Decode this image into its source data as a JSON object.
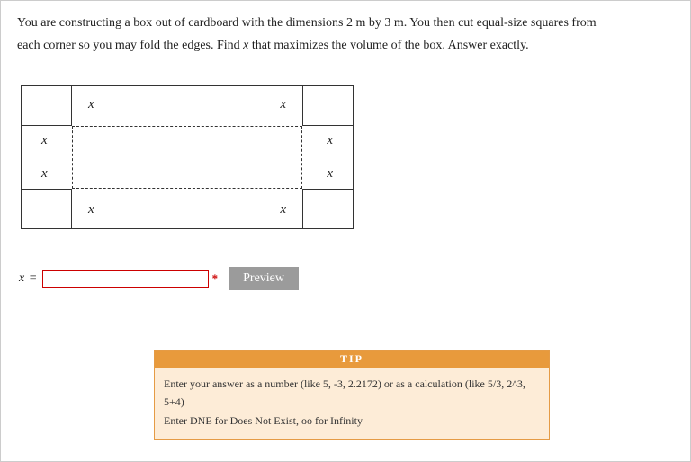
{
  "problem": {
    "line1_before": "You are constructing a box out of cardboard with the dimensions 2 m by 3 m. You then cut equal-size squares from",
    "line2_before": "each corner so you may fold the edges. Find ",
    "line2_var": "x",
    "line2_after": " that maximizes the volume of the box. Answer exactly."
  },
  "diagram": {
    "label": "x"
  },
  "answer": {
    "lhs_var": "x",
    "equals": " =",
    "value": "",
    "required_mark": "*",
    "preview_label": "Preview"
  },
  "tip": {
    "header": "TIP",
    "body_line1": "Enter your answer as a number (like 5, -3, 2.2172) or as a calculation (like 5/3, 2^3, 5+4)",
    "body_line2": "Enter DNE for Does Not Exist, oo for Infinity"
  }
}
